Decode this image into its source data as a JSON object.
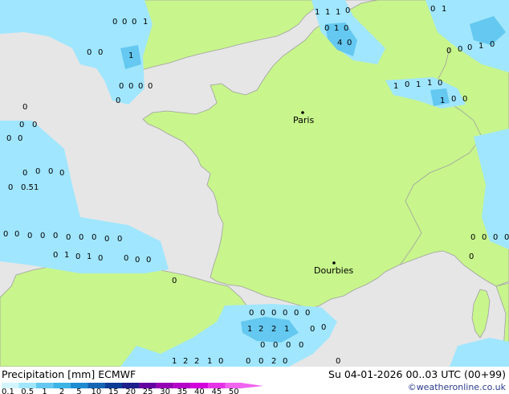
{
  "map": {
    "cities": [
      {
        "name": "Paris"
      },
      {
        "name": "Dourbies"
      }
    ],
    "colors": {
      "land": "#c8f58c",
      "sea": "#e6e6e6",
      "border": "#a0a0a0",
      "precip_light": "#a0e6ff",
      "precip_mid": "#64c8f0"
    }
  },
  "legend": {
    "title": "Precipitation [mm]",
    "model": "ECMWF",
    "date": "Su 04-01-2026 00..03 UTC (00+99)",
    "credit": "©weatheronline.co.uk",
    "ticks": [
      "0.1",
      "0.5",
      "1",
      "2",
      "5",
      "10",
      "15",
      "20",
      "25",
      "30",
      "35",
      "40",
      "45",
      "50"
    ],
    "colors": [
      "#d2f5ff",
      "#a0e6ff",
      "#64c8f0",
      "#3cb4e6",
      "#1e8cd2",
      "#1464b4",
      "#0a3c96",
      "#1e1e8c",
      "#6400a0",
      "#9600b4",
      "#b400c8",
      "#d200dc",
      "#e632e6",
      "#f064f0"
    ]
  }
}
